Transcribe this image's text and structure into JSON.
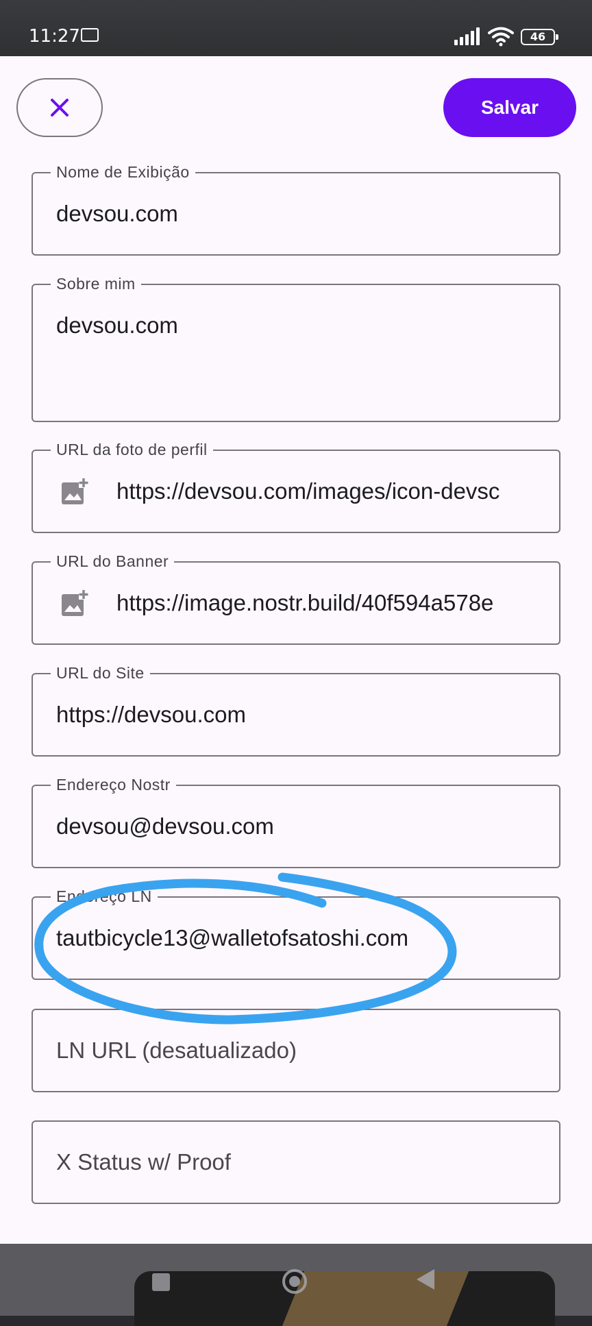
{
  "status_bar": {
    "time": "11:27",
    "battery": "46"
  },
  "actions": {
    "close_icon": "close-icon",
    "save_label": "Salvar"
  },
  "form": {
    "display_name": {
      "label": "Nome de Exibição",
      "value": "devsou.com"
    },
    "about": {
      "label": "Sobre mim",
      "value": "devsou.com"
    },
    "picture_url": {
      "label": "URL da foto de perfil",
      "value": "https://devsou.com/images/icon-devsc",
      "icon": "add-photo-icon"
    },
    "banner_url": {
      "label": "URL do Banner",
      "value": "https://image.nostr.build/40f594a578e",
      "icon": "add-photo-icon"
    },
    "website": {
      "label": "URL do Site",
      "value": "https://devsou.com"
    },
    "nostr_address": {
      "label": "Endereço Nostr",
      "value": "devsou@devsou.com"
    },
    "ln_address": {
      "label": "Endereço LN",
      "value": "tautbicycle13@walletofsatoshi.com"
    },
    "ln_url": {
      "placeholder": "LN URL (desatualizado)"
    },
    "x_status": {
      "placeholder": "X Status w/ Proof"
    }
  },
  "colors": {
    "accent": "#6a0ff0",
    "outline": "#79747e",
    "sheet_background": "#fdf8fd",
    "annotation": "#3aa3ef"
  }
}
